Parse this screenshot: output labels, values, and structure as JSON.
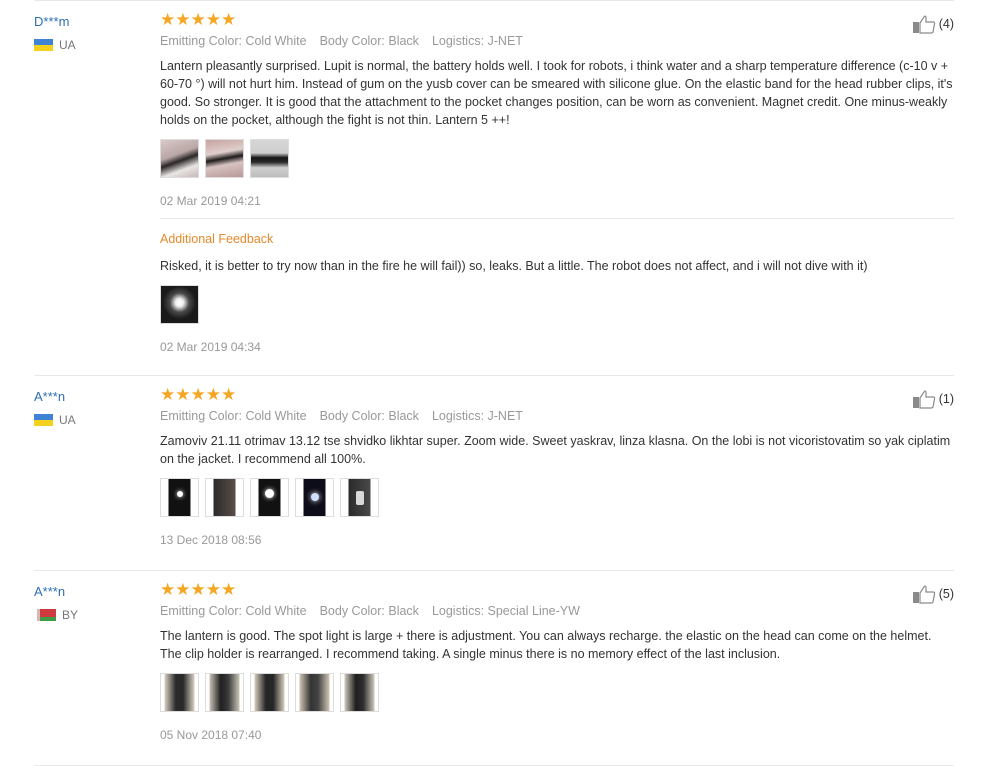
{
  "reviews": [
    {
      "user": "D***m",
      "country": "UA",
      "stars": "★★★★★",
      "rating": 5,
      "color": "Emitting Color: Cold White",
      "body_color": "Body Color: Black",
      "logistics": "Logistics: J-NET",
      "helpful": "(4)",
      "text": "Lantern pleasantly surprised. Lupit is normal, the battery holds well. I took for robots, i think water and a sharp temperature difference (c-10 v + 60-70 °) will not hurt him. Instead of gum on the yusb cover can be smeared with silicone glue. On the elastic band for the head rubber clips, it's good. So stronger. It is good that the attachment to the pocket changes position, can be worn as convenient. Magnet credit. One minus-weakly holds on the pocket, although the fight is not thin. Lantern 5 ++!",
      "date": "02 Mar 2019 04:21",
      "additional": {
        "title": "Additional Feedback",
        "text": "Risked, it is better to try now than in the fire he will fail)) so, leaks. But a little. The robot does not affect, and i will not dive with it)",
        "date": "02 Mar 2019 04:34"
      }
    },
    {
      "user": "A***n",
      "country": "UA",
      "stars": "★★★★★",
      "rating": 5,
      "color": "Emitting Color: Cold White",
      "body_color": "Body Color: Black",
      "logistics": "Logistics: J-NET",
      "helpful": "(1)",
      "text": "Zamoviv 21.11 otrimav 13.12 tse shvidko likhtar super. Zoom wide. Sweet yaskrav, linza klasna. On the lobi is not vicoristovatim so yak ciplatim on the jacket. I recommend all 100%.",
      "date": "13 Dec 2018 08:56"
    },
    {
      "user": "A***n",
      "country": "BY",
      "stars": "★★★★★",
      "rating": 5,
      "color": "Emitting Color: Cold White",
      "body_color": "Body Color: Black",
      "logistics": "Logistics: Special Line-YW",
      "helpful": "(5)",
      "text": "The lantern is good. The spot light is large + there is adjustment. You can always recharge. the elastic on the head can come on the helmet. The clip holder is rearranged. I recommend taking. A single minus there is no memory effect of the last inclusion.",
      "date": "05 Nov 2018 07:40"
    }
  ]
}
